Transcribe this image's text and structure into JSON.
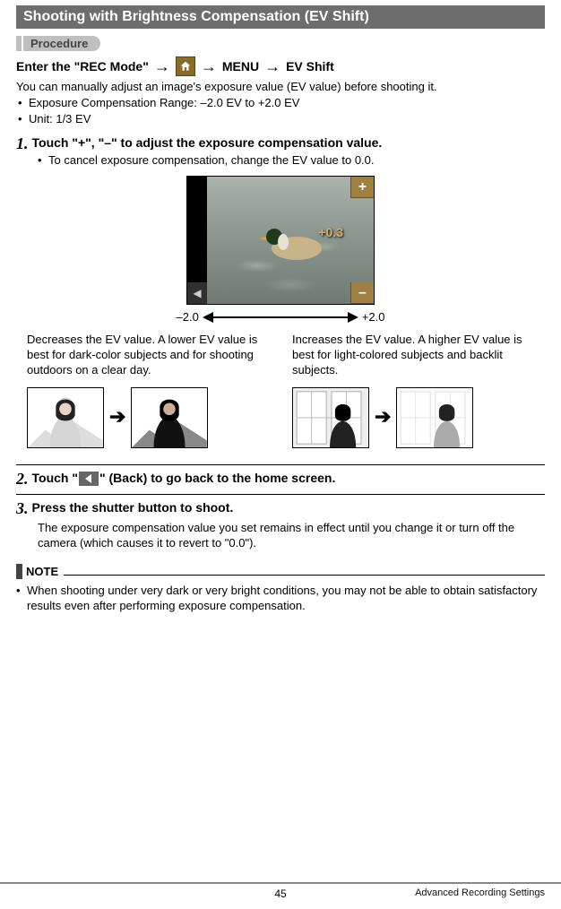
{
  "title": "Shooting with Brightness Compensation (EV Shift)",
  "procedure_label": "Procedure",
  "enter_line": {
    "prefix": "Enter the \"REC Mode\"",
    "menu": "MENU",
    "item": "EV Shift"
  },
  "intro": "You can manually adjust an image's exposure value (EV value) before shooting it.",
  "specs": [
    "Exposure Compensation Range: –2.0 EV to +2.0 EV",
    "Unit: 1/3 EV"
  ],
  "steps": [
    {
      "num": "1.",
      "title": "Touch \"+\", \"–\" to adjust the exposure compensation value.",
      "sub": [
        "To cancel exposure compensation, change the EV value to 0.0."
      ]
    },
    {
      "num": "2.",
      "title_pre": "Touch \"",
      "title_post": "\" (Back) to go back to the home screen."
    },
    {
      "num": "3.",
      "title": "Press the shutter button to shoot.",
      "body": "The exposure compensation value you set remains in effect until you change it or turn off the camera (which causes it to revert to \"0.0\")."
    }
  ],
  "figure": {
    "ev_readout": "+0.3",
    "range_low": "–2.0",
    "range_high": "+2.0",
    "plus": "+",
    "minus": "–",
    "left_arrow": "◀"
  },
  "columns": {
    "left": "Decreases the EV value. A lower EV value is best for dark-color subjects and for shooting outdoors on a clear day.",
    "right": "Increases the EV value. A higher EV value is best for light-colored subjects and backlit subjects."
  },
  "note": {
    "label": "NOTE",
    "items": [
      "When shooting under very dark or very bright conditions, you may not be able to obtain satisfactory results even after performing exposure compensation."
    ]
  },
  "footer": {
    "page": "45",
    "section": "Advanced Recording Settings"
  }
}
